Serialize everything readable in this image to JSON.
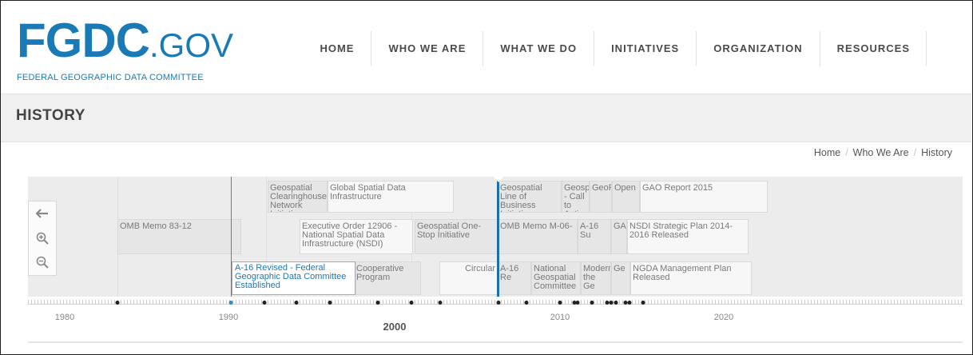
{
  "logo": {
    "main": "FGDC",
    "suffix": ".GOV",
    "subtitle": "FEDERAL GEOGRAPHIC DATA COMMITTEE"
  },
  "nav": [
    "HOME",
    "WHO WE ARE",
    "WHAT WE DO",
    "INITIATIVES",
    "ORGANIZATION",
    "RESOURCES"
  ],
  "page_title": "HISTORY",
  "breadcrumb": [
    "Home",
    "Who We Are",
    "History"
  ],
  "timeline": {
    "tooltip": "A-16 Revised - Federal Geographic Data Committee Established",
    "years": [
      "1980",
      "1990",
      "2010",
      "2020"
    ],
    "current_year": "2000",
    "events": [
      "Geospatial Clearinghouse Network Initiative",
      "Global Spatial Data Infrastructure",
      "Geospatial Line of Business Initiative",
      "Geospatial - Call to Action",
      "GeoPlatform",
      "Open",
      "GAO Report 2015",
      "OMB Memo 83-12",
      "Executive Order 12906 - National Spatial Data Infrastructure (NSDI)",
      "Geospatial One-Stop Initiative",
      "OMB Memo M-06-",
      "A-16 Su",
      "GA",
      "NSDI Strategic Plan 2014-2016 Released",
      "Cooperative Program",
      "Circular",
      "A-16 Re",
      "National Geospatial Committee",
      "Modern the Ge",
      "Ge",
      "NGDA Management Plan Released"
    ]
  },
  "colors": {
    "brand": "#1a7ab5",
    "marker": "#1a6fae"
  },
  "icons": [
    "back-arrow-icon",
    "zoom-in-icon",
    "zoom-out-icon"
  ]
}
